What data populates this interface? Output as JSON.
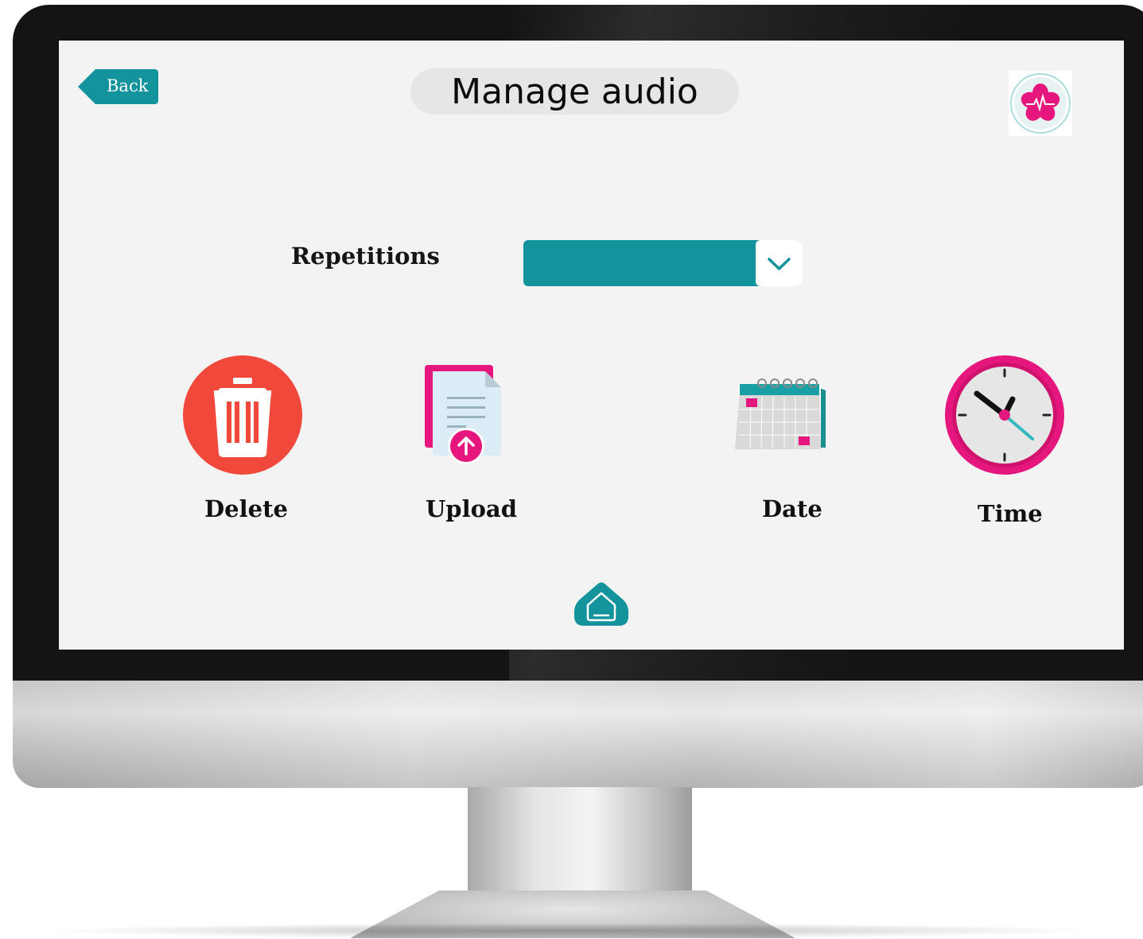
{
  "header": {
    "back_label": "Back",
    "title": "Manage audio",
    "logo_icon": "medical-star-logo-icon"
  },
  "repetitions": {
    "label": "Repetitions",
    "value": ""
  },
  "actions": [
    {
      "label": "Delete",
      "icon": "trash-icon"
    },
    {
      "label": "Upload",
      "icon": "upload-document-icon"
    },
    {
      "label": "Date",
      "icon": "calendar-icon"
    },
    {
      "label": "Time",
      "icon": "clock-icon"
    }
  ],
  "footer": {
    "home_icon": "home-icon"
  },
  "colors": {
    "accent_teal": "#13939c",
    "pink": "#e5177e",
    "delete_red": "#f0483b",
    "screen_bg": "#f3f3f3"
  }
}
